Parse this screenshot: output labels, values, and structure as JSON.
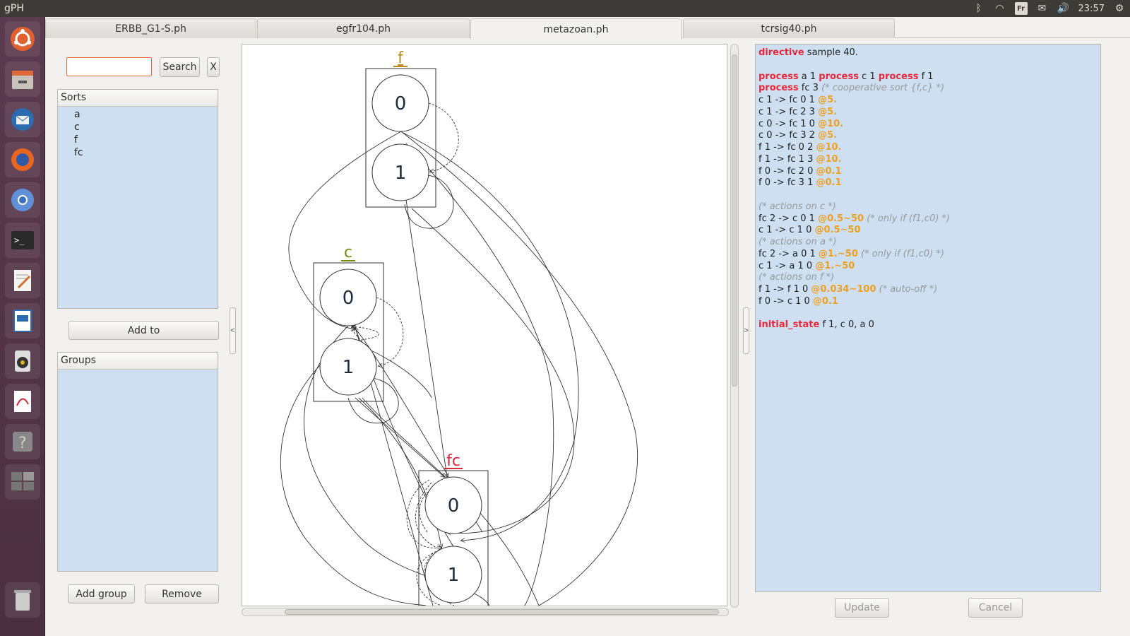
{
  "app": {
    "title": "gPH"
  },
  "tray": {
    "keyboard": "Fr",
    "clock": "23:57"
  },
  "tabs": [
    {
      "label": "ERBB_G1-S.ph"
    },
    {
      "label": "egfr104.ph"
    },
    {
      "label": "metazoan.ph",
      "active": true
    },
    {
      "label": "tcrsig40.ph"
    }
  ],
  "left_panel": {
    "search": {
      "value": "",
      "button": "Search",
      "clear": "X"
    },
    "sorts": {
      "header": "Sorts",
      "items": [
        "a",
        "c",
        "f",
        "fc"
      ]
    },
    "add_to": "Add to",
    "groups": {
      "header": "Groups",
      "items": []
    },
    "add_group": "Add group",
    "remove": "Remove",
    "collapse_left": "<",
    "collapse_right": ">"
  },
  "graph": {
    "sorts": [
      {
        "name": "f",
        "color": "#c08a10",
        "states": [
          "0",
          "1"
        ]
      },
      {
        "name": "c",
        "color": "#7a8a10",
        "states": [
          "0",
          "1"
        ]
      },
      {
        "name": "fc",
        "color": "#d8283a",
        "states": [
          "0",
          "1"
        ]
      }
    ]
  },
  "code": {
    "lines": [
      [
        {
          "t": "directive",
          "c": "kw"
        },
        {
          "t": " sample 40."
        }
      ],
      [],
      [
        {
          "t": "process",
          "c": "kw"
        },
        {
          "t": " a 1 "
        },
        {
          "t": "process",
          "c": "kw"
        },
        {
          "t": " c 1 "
        },
        {
          "t": "process",
          "c": "kw"
        },
        {
          "t": " f 1"
        }
      ],
      [
        {
          "t": "process",
          "c": "kw"
        },
        {
          "t": " fc 3 "
        },
        {
          "t": "(* cooperative sort {f,c} *)",
          "c": "cmt"
        }
      ],
      [
        {
          "t": "c 1 -> fc 0 1 "
        },
        {
          "t": "@5.",
          "c": "rate"
        }
      ],
      [
        {
          "t": "c 1 -> fc 2 3 "
        },
        {
          "t": "@5.",
          "c": "rate"
        }
      ],
      [
        {
          "t": "c 0 -> fc 1 0 "
        },
        {
          "t": "@10.",
          "c": "rate"
        }
      ],
      [
        {
          "t": "c 0 -> fc 3 2 "
        },
        {
          "t": "@5.",
          "c": "rate"
        }
      ],
      [
        {
          "t": "f 1 -> fc 0 2 "
        },
        {
          "t": "@10.",
          "c": "rate"
        }
      ],
      [
        {
          "t": "f 1 -> fc 1 3 "
        },
        {
          "t": "@10.",
          "c": "rate"
        }
      ],
      [
        {
          "t": "f 0 -> fc 2 0 "
        },
        {
          "t": "@0.1",
          "c": "rate"
        }
      ],
      [
        {
          "t": "f 0 -> fc 3 1 "
        },
        {
          "t": "@0.1",
          "c": "rate"
        }
      ],
      [],
      [
        {
          "t": "(* actions on c *)",
          "c": "cmt"
        }
      ],
      [
        {
          "t": "fc 2 -> c 0 1 "
        },
        {
          "t": "@0.5~50",
          "c": "rate"
        },
        {
          "t": " "
        },
        {
          "t": "(* only if (f1,c0) *)",
          "c": "cmt"
        }
      ],
      [
        {
          "t": "c 1 -> c 1 0 "
        },
        {
          "t": "@0.5~50",
          "c": "rate"
        }
      ],
      [
        {
          "t": "(* actions on a *)",
          "c": "cmt"
        }
      ],
      [
        {
          "t": "fc 2 -> a 0 1 "
        },
        {
          "t": "@1.~50",
          "c": "rate"
        },
        {
          "t": " "
        },
        {
          "t": "(* only if (f1,c0) *)",
          "c": "cmt"
        }
      ],
      [
        {
          "t": "c 1 -> a 1 0 "
        },
        {
          "t": "@1.~50",
          "c": "rate"
        }
      ],
      [
        {
          "t": "(* actions on f *)",
          "c": "cmt"
        }
      ],
      [
        {
          "t": "f 1 -> f 1 0 "
        },
        {
          "t": "@0.034~100",
          "c": "rate"
        },
        {
          "t": " "
        },
        {
          "t": "(* auto-off *)",
          "c": "cmt"
        }
      ],
      [
        {
          "t": "f 0 -> c 1 0 "
        },
        {
          "t": "@0.1",
          "c": "rate"
        }
      ],
      [],
      [
        {
          "t": "initial_state",
          "c": "kw"
        },
        {
          "t": " f 1, c 0, a 0"
        }
      ]
    ]
  },
  "buttons": {
    "update": "Update",
    "cancel": "Cancel"
  },
  "launcher_items": [
    "ubuntu-dash",
    "files",
    "thunderbird",
    "firefox",
    "chromium",
    "terminal",
    "text-editor",
    "writer",
    "rhythmbox",
    "document-viewer",
    "help",
    "workspace-switcher",
    "trash"
  ]
}
